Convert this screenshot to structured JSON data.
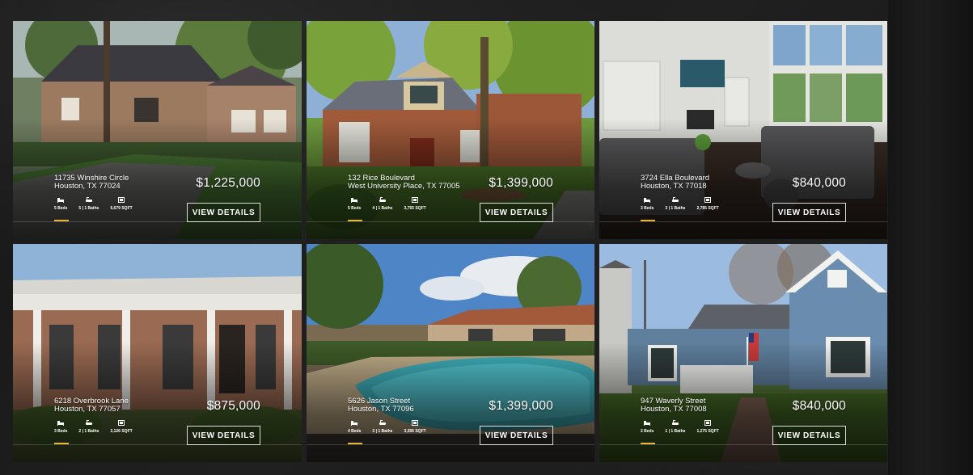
{
  "listings": [
    {
      "street": "11735 Winshire Circle",
      "city": "Houston, TX 77024",
      "price": "$1,225,000",
      "beds": "5 Beds",
      "baths": "5 | 1 Baths",
      "sqft": "6,679 SQFT",
      "button": "VIEW DETAILS"
    },
    {
      "street": "132 Rice Boulevard",
      "city": "West University Place, TX 77005",
      "price": "$1,399,000",
      "beds": "5 Beds",
      "baths": "4 | 1 Baths",
      "sqft": "3,755 SQFT",
      "button": "VIEW DETAILS"
    },
    {
      "street": "3724 Ella Boulevard",
      "city": "Houston, TX 77018",
      "price": "$840,000",
      "beds": "3 Beds",
      "baths": "3 | 1 Baths",
      "sqft": "2,785 SQFT",
      "button": "VIEW DETAILS"
    },
    {
      "street": "6218 Overbrook Lane",
      "city": "Houston, TX 77057",
      "price": "$875,000",
      "beds": "3 Beds",
      "baths": "2 | 1 Baths",
      "sqft": "2,126 SQFT",
      "button": "VIEW DETAILS"
    },
    {
      "street": "5626 Jason Street",
      "city": "Houston, TX 77096",
      "price": "$1,399,000",
      "beds": "4 Beds",
      "baths": "3 | 1 Baths",
      "sqft": "3,356 SQFT",
      "button": "VIEW DETAILS"
    },
    {
      "street": "947 Waverly Street",
      "city": "Houston, TX 77008",
      "price": "$840,000",
      "beds": "2 Beds",
      "baths": "1 | 1 Baths",
      "sqft": "1,275 SQFT",
      "button": "VIEW DETAILS"
    }
  ],
  "icons": {
    "beds": "bed-icon",
    "baths": "bath-icon",
    "sqft": "area-icon"
  },
  "colors": {
    "accent": "#e8b53a",
    "background": "#1a1a1a",
    "text": "#ffffff"
  }
}
